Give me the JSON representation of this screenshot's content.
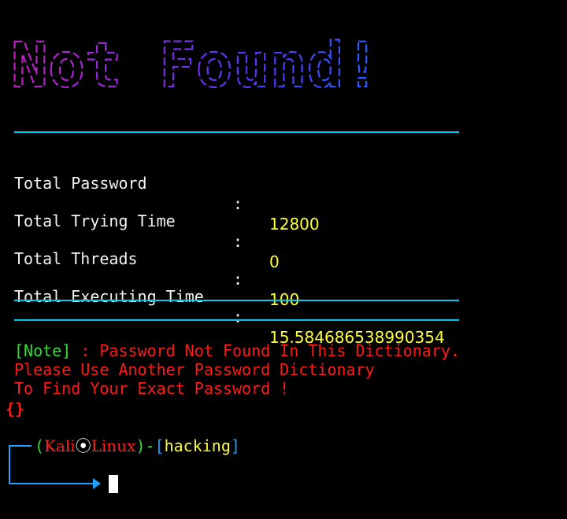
{
  "banner": {
    "text": "Not Found!",
    "colors": [
      "#c020c0",
      "#8a2be2",
      "#4b3aff",
      "#2a60ff"
    ]
  },
  "stats": [
    {
      "label": "Total Password",
      "value": "12800"
    },
    {
      "label": "Total Trying Time",
      "value": "0"
    },
    {
      "label": "Total Threads",
      "value": "100"
    },
    {
      "label": "Total Executing Time",
      "value": "15.584686538990354"
    }
  ],
  "separator": ":",
  "note": {
    "tag": "[Note]",
    "line1": " : Password Not Found In This Dictionary.",
    "line2": "Please Use Another Password Dictionary",
    "line3": "To Find Your Exact Password !",
    "braces": "{}"
  },
  "prompt": {
    "open": "(",
    "user": "Kali",
    "skull": "⦿",
    "host": "Linux",
    "close": ")",
    "dash": "-",
    "dir_open": "[",
    "dir": "hacking",
    "dir_close": "]"
  },
  "colors": {
    "rule": "#00c8e6",
    "value": "#ffff33",
    "error": "#ff1a1a",
    "tag": "#33dd33"
  }
}
